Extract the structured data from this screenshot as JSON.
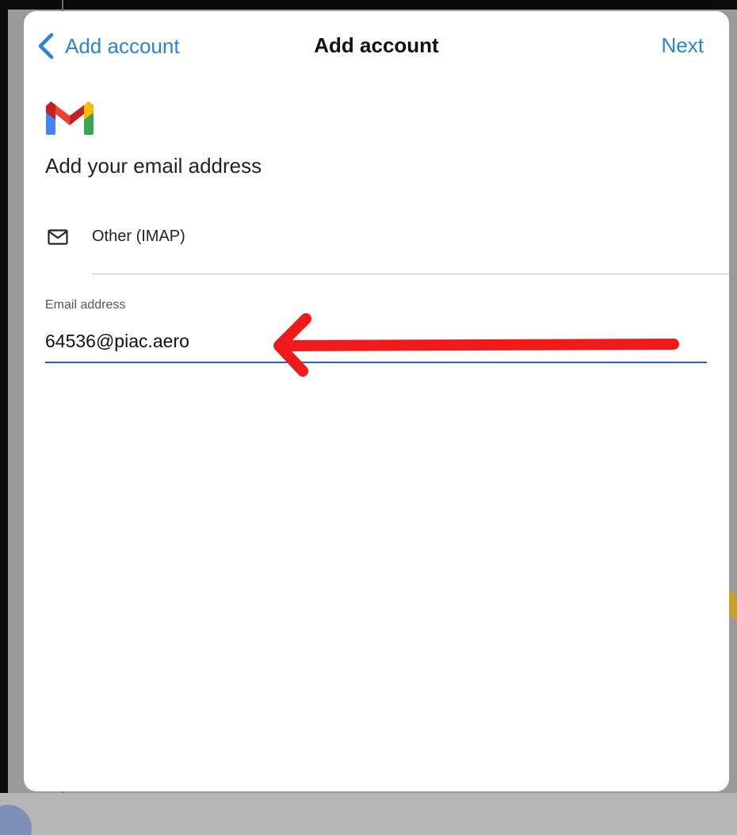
{
  "navbar": {
    "back_label": "Add account",
    "title": "Add account",
    "next_label": "Next"
  },
  "content": {
    "heading": "Add your email address",
    "provider": {
      "label": "Other (IMAP)",
      "icon": "mail-icon"
    },
    "email_field": {
      "label": "Email address",
      "value": "64536@piac.aero"
    }
  },
  "colors": {
    "accent": "#2a83d6",
    "underline": "#2f5fa8",
    "annotation_arrow": "#f01a1a"
  }
}
